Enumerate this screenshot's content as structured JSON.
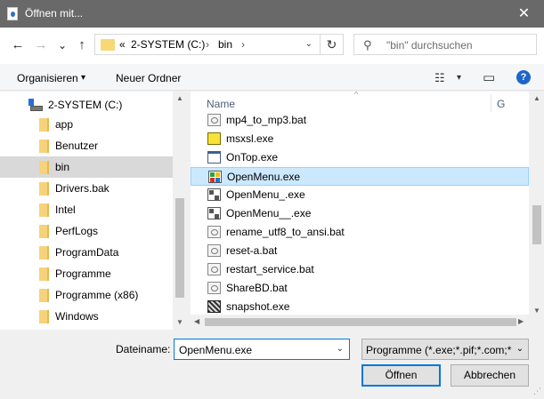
{
  "window": {
    "title": "Öffnen mit...",
    "close_glyph": "✕"
  },
  "nav": {
    "back_glyph": "←",
    "forward_glyph": "→",
    "recent_glyph": "⌄",
    "up_glyph": "↑",
    "address": {
      "overflow": "«",
      "segments": [
        "2-SYSTEM (C:)",
        "bin"
      ],
      "separators": [
        "›",
        "›"
      ],
      "dropdown_glyph": "⌄",
      "refresh_glyph": "↻"
    },
    "search": {
      "placeholder": "\"bin\" durchsuchen",
      "icon_glyph": "⚲"
    }
  },
  "toolbar": {
    "organize_label": "Organisieren",
    "organize_caret": "▾",
    "new_folder_label": "Neuer Ordner",
    "view_glyph": "☷",
    "view_caret": "▾",
    "preview_glyph": "▭",
    "help_glyph": "?"
  },
  "tree": {
    "drive_label": "2-SYSTEM (C:)",
    "folders": [
      "app",
      "Benutzer",
      "bin",
      "Drivers.bak",
      "Intel",
      "PerfLogs",
      "ProgramData",
      "Programme",
      "Programme (x86)",
      "Windows"
    ],
    "selected": "bin",
    "scroll_up": "▲",
    "scroll_down": "▼"
  },
  "content": {
    "column_name": "Name",
    "column_next": "G",
    "sort_glyph": "^",
    "files": [
      {
        "name": "mp4_to_mp3.bat",
        "icon": "bat-file-icon"
      },
      {
        "name": "msxsl.exe",
        "icon": "msxsl-app-icon"
      },
      {
        "name": "OnTop.exe",
        "icon": "exe-window-icon"
      },
      {
        "name": "OpenMenu.exe",
        "icon": "openmenu-app-icon"
      },
      {
        "name": "OpenMenu_.exe",
        "icon": "exe-grid-icon"
      },
      {
        "name": "OpenMenu__.exe",
        "icon": "exe-grid-icon"
      },
      {
        "name": "rename_utf8_to_ansi.bat",
        "icon": "bat-file-icon"
      },
      {
        "name": "reset-a.bat",
        "icon": "bat-file-icon"
      },
      {
        "name": "restart_service.bat",
        "icon": "bat-file-icon"
      },
      {
        "name": "ShareBD.bat",
        "icon": "bat-file-icon"
      },
      {
        "name": "snapshot.exe",
        "icon": "snapshot-app-icon"
      }
    ],
    "selected": "OpenMenu.exe",
    "scroll_up": "▲",
    "scroll_down": "▼",
    "scroll_left": "◀",
    "scroll_right": "▶"
  },
  "footer": {
    "filename_label": "Dateiname:",
    "filename_value": "OpenMenu.exe",
    "filename_dropdown": "⌄",
    "filetype_value": "Programme (*.exe;*.pif;*.com;*",
    "filetype_dropdown": "⌄",
    "open_label": "Öffnen",
    "cancel_label": "Abbrechen",
    "grip_glyph": "⋰"
  },
  "colors": {
    "accent": "#0078d7",
    "selection": "#cce8ff",
    "titlebar": "#696969"
  }
}
